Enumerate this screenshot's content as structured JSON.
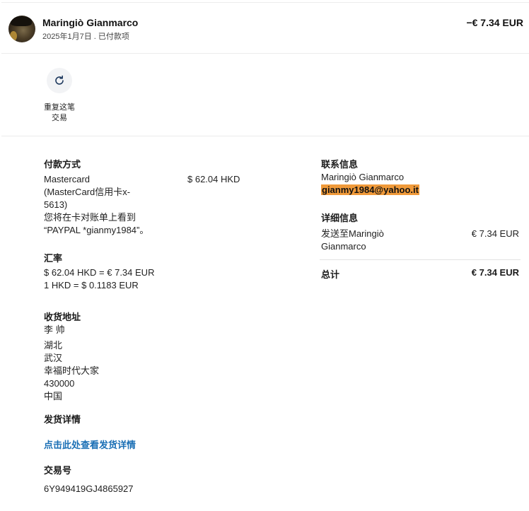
{
  "header": {
    "name": "Maringiò Gianmarco",
    "subtitle": "2025年1月7日 . 已付款项",
    "amount": "−€ 7.34 EUR"
  },
  "action": {
    "repeat_label_line1": "重复这笔",
    "repeat_label_line2": "交易"
  },
  "payment": {
    "title": "付款方式",
    "lines": [
      "Mastercard",
      "(MasterCard信用卡x-",
      "5613)",
      "您将在卡对账单上看到",
      "“PAYPAL *gianmy1984”。"
    ],
    "amount": "$ 62.04 HKD"
  },
  "exchange": {
    "title": "汇率",
    "line1": "$ 62.04 HKD = € 7.34 EUR",
    "line2": "1 HKD = $ 0.1183 EUR"
  },
  "shipping_address": {
    "title": "收货地址",
    "lines": [
      "李 帅",
      "湖北",
      "武汉",
      "幸福时代大家",
      "430000",
      "中国"
    ]
  },
  "shipping_details": {
    "title": "发货详情",
    "link": "点击此处查看发货详情"
  },
  "transaction": {
    "title": "交易号",
    "id": "6Y949419GJ4865927"
  },
  "contact": {
    "title": "联系信息",
    "name": "Maringiò Gianmarco",
    "email": "gianmy1984@yahoo.it"
  },
  "details": {
    "title": "详细信息",
    "sent_to_line1": "发送至Maringiò",
    "sent_to_line2": "Gianmarco",
    "sent_amount": "€ 7.34 EUR",
    "total_label": "总计",
    "total_amount": "€ 7.34 EUR"
  }
}
